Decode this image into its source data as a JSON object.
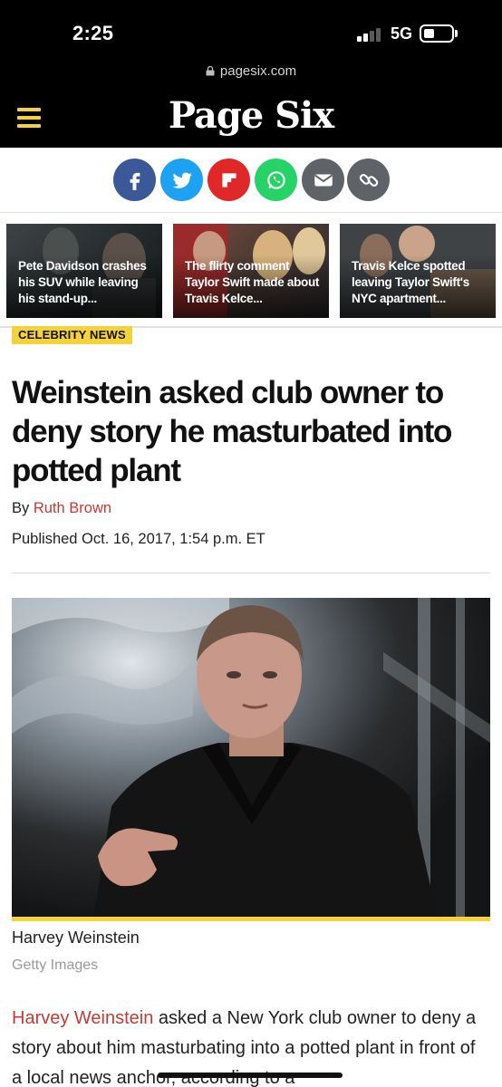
{
  "status_bar": {
    "time": "2:25",
    "network": "5G"
  },
  "browser": {
    "url": "pagesix.com"
  },
  "site": {
    "logo": "Page Six"
  },
  "share": [
    {
      "name": "facebook-share-button",
      "icon": "facebook-icon",
      "color": "#3b5998"
    },
    {
      "name": "twitter-share-button",
      "icon": "twitter-icon",
      "color": "#1da1f2"
    },
    {
      "name": "flipboard-share-button",
      "icon": "flipboard-icon",
      "color": "#e12828"
    },
    {
      "name": "whatsapp-share-button",
      "icon": "whatsapp-icon",
      "color": "#25d366"
    },
    {
      "name": "email-share-button",
      "icon": "email-icon",
      "color": "#5f6368"
    },
    {
      "name": "copy-link-button",
      "icon": "link-icon",
      "color": "#5f6368"
    }
  ],
  "related": [
    {
      "text": "Pete Davidson crashes his SUV while leaving his stand-up..."
    },
    {
      "text": "The flirty comment Taylor Swift made about Travis Kelce..."
    },
    {
      "text": "Travis Kelce spotted leaving Taylor Swift's NYC apartment..."
    }
  ],
  "article": {
    "category": "CELEBRITY NEWS",
    "headline": "Weinstein asked club owner to deny story he masturbated into potted plant",
    "byline_prefix": "By ",
    "author": "Ruth Brown",
    "published": "Published Oct. 16, 2017, 1:54 p.m. ET",
    "photo_caption": "Harvey Weinstein",
    "photo_credit": "Getty Images",
    "body_link": "Harvey Weinstein",
    "body_text": " asked a New York club owner to deny a story about him masturbating into a potted plant in front of a local news anchor, according to a"
  },
  "colors": {
    "accent_yellow": "#f4d23a",
    "link_red": "#c43b35"
  }
}
